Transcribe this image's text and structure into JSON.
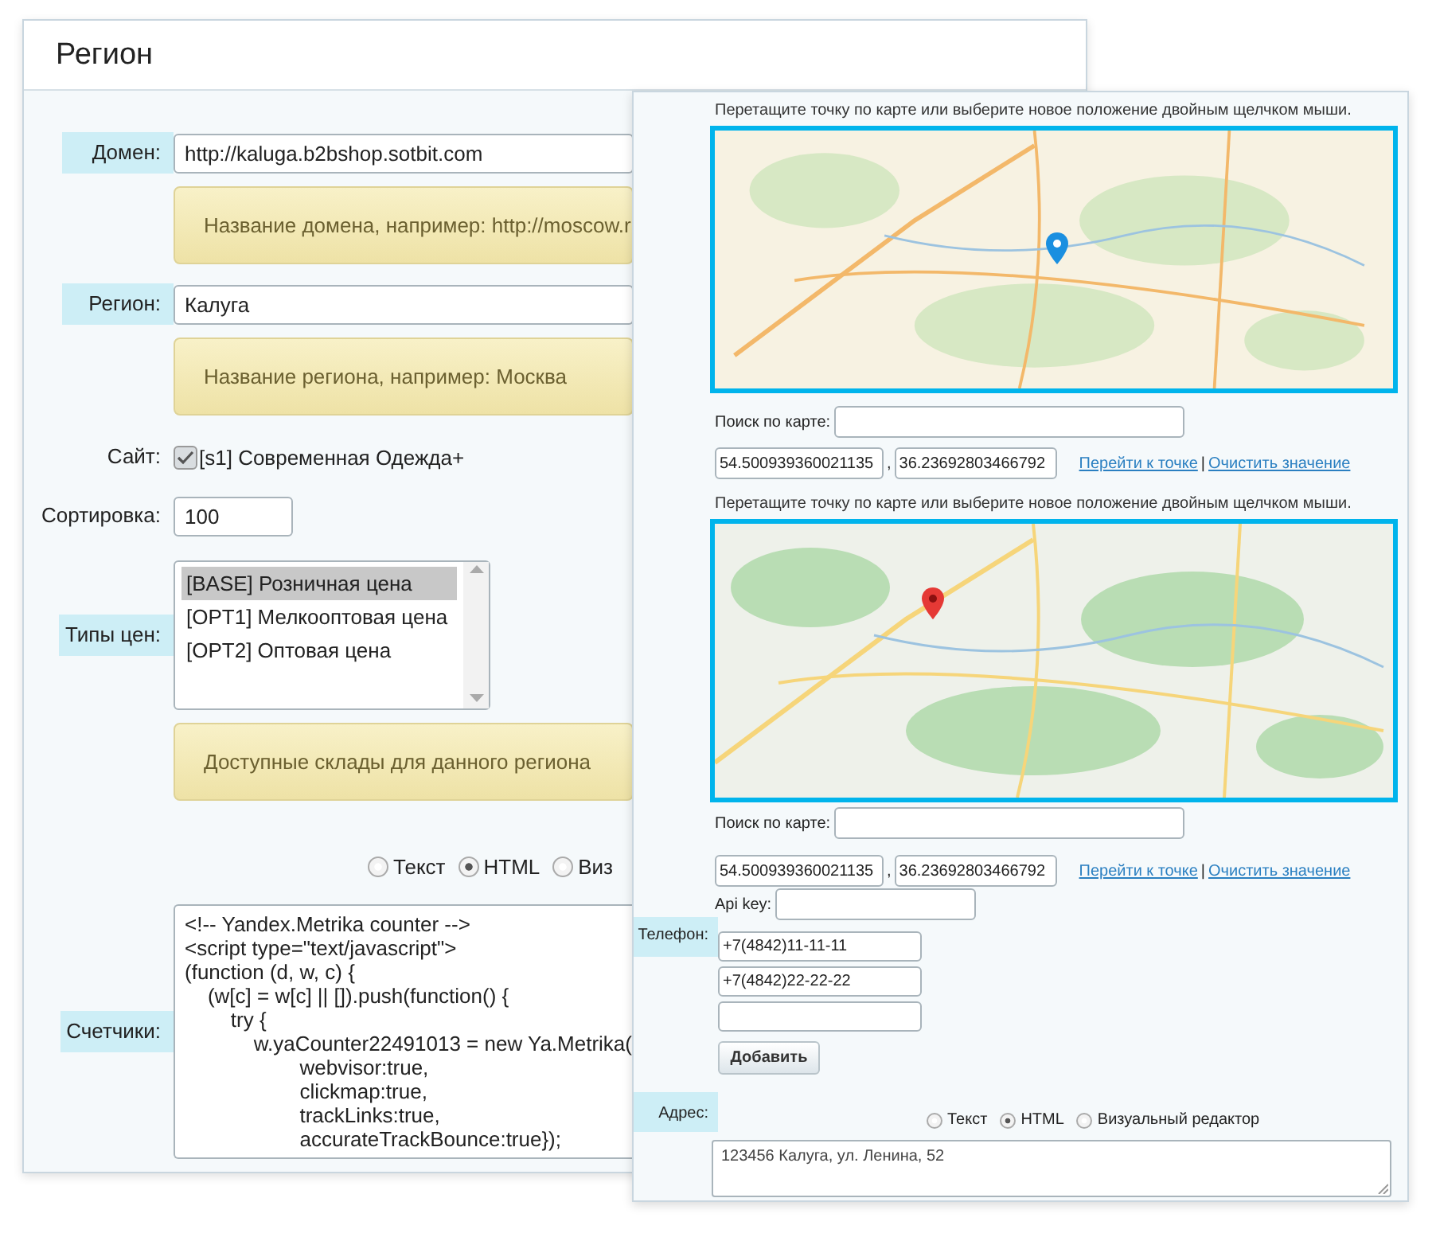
{
  "left_window": {
    "title": "Регион",
    "fields": [
      {
        "kind": "text",
        "label": "Домен:",
        "highlighted": true,
        "value": "http://kaluga.b2bshop.sotbit.com"
      },
      {
        "kind": "hint",
        "text": "Название домена, например: http://moscow.r"
      },
      {
        "kind": "text",
        "label": "Регион:",
        "highlighted": true,
        "value": "Калуга"
      },
      {
        "kind": "hint",
        "text": "Название региона, например: Москва"
      },
      {
        "kind": "checkbox",
        "label": "Сайт:",
        "highlighted": false,
        "checked": true,
        "text": "[s1] Современная Одежда+"
      },
      {
        "kind": "short_text",
        "label": "Сортировка:",
        "highlighted": false,
        "value": "100"
      },
      {
        "kind": "listbox",
        "label": "Типы цен:",
        "highlighted": true,
        "options": [
          {
            "text": "[BASE] Розничная цена",
            "selected": true
          },
          {
            "text": "[OPT1] Мелкооптовая цена",
            "selected": false
          },
          {
            "text": "[OPT2] Оптовая цена",
            "selected": false
          }
        ]
      },
      {
        "kind": "hint",
        "text": "Доступные склады для данного региона"
      },
      {
        "kind": "radios",
        "options": [
          {
            "label": "Текст",
            "selected": false
          },
          {
            "label": "HTML",
            "selected": true
          },
          {
            "label": "Виз",
            "selected": false
          }
        ]
      },
      {
        "kind": "code",
        "label": "Счетчики:",
        "highlighted": true,
        "lines": [
          "<!-- Yandex.Metrika counter -->",
          "<script type=\"text/javascript\">",
          "(function (d, w, c) {",
          "    (w[c] = w[c] || []).push(function() {",
          "        try {",
          "            w.yaCounter22491013 = new Ya.Metrika(",
          "                    webvisor:true,",
          "                    clickmap:true,",
          "                    trackLinks:true,",
          "                    accurateTrackBounce:true});"
        ]
      }
    ]
  },
  "right_window": {
    "maps": [
      {
        "kind": "yandex",
        "caption": "Перетащите точку по карте или выберите новое положение двойным щелчком мыши.",
        "search_label": "Поиск по карте:",
        "lat": "54.500939360021135",
        "separator": ",",
        "lng": "36.23692803466792",
        "goto_link": "Перейти к точке",
        "divider": "|",
        "clear_link": "Очистить значение"
      },
      {
        "kind": "google",
        "caption": "Перетащите точку по карте или выберите новое положение двойным щелчком мыши.",
        "search_label": "Поиск по карте:",
        "lat": "54.500939360021135",
        "separator": ",",
        "lng": "36.23692803466792",
        "goto_link": "Перейти к точке",
        "divider": "|",
        "clear_link": "Очистить значение"
      }
    ],
    "api_key_label": "Api key:",
    "phone": {
      "label": "Телефон:",
      "values": [
        "+7(4842)11-11-11",
        "+7(4842)22-22-22"
      ],
      "add_button": "Добавить"
    },
    "address": {
      "label": "Адрес:",
      "modes": [
        {
          "label": "Текст",
          "selected": false
        },
        {
          "label": "HTML",
          "selected": true
        },
        {
          "label": "Визуальный редактор",
          "selected": false
        }
      ],
      "value": "123456 Калуга, ул. Ленина, 52"
    }
  }
}
